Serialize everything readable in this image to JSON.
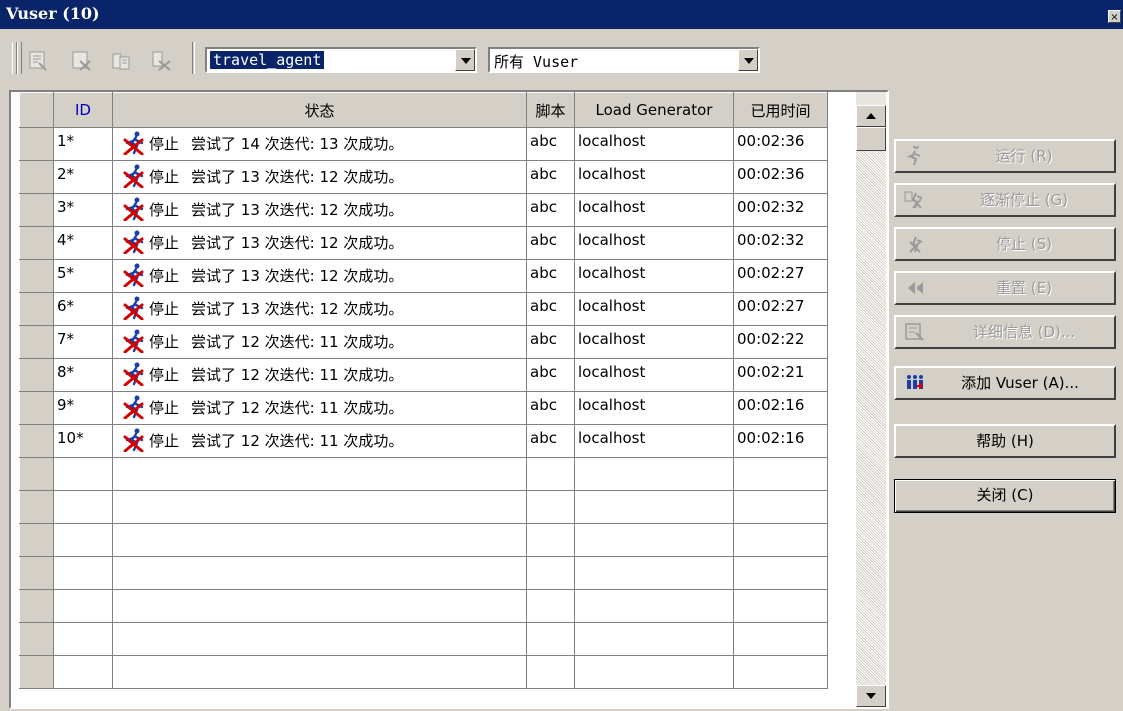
{
  "window": {
    "title": "Vuser (10)",
    "close_glyph": "×"
  },
  "toolbar": {
    "icons": [
      "vuser-details-icon",
      "vuser-stop-icon",
      "vuser-log-icon",
      "vuser-filter-icon"
    ],
    "group_combo": {
      "value": "travel_agent"
    },
    "filter_combo": {
      "value": "所有 Vuser"
    }
  },
  "grid": {
    "columns": [
      "ID",
      "状态",
      "脚本",
      "Load Generator",
      "已用时间"
    ],
    "rows": [
      {
        "id": "1*",
        "status_word": "停止",
        "status_detail": "尝试了 14 次迭代: 13 次成功。",
        "script": "abc",
        "generator": "localhost",
        "elapsed": "00:02:36"
      },
      {
        "id": "2*",
        "status_word": "停止",
        "status_detail": "尝试了 13 次迭代: 12 次成功。",
        "script": "abc",
        "generator": "localhost",
        "elapsed": "00:02:36"
      },
      {
        "id": "3*",
        "status_word": "停止",
        "status_detail": "尝试了 13 次迭代: 12 次成功。",
        "script": "abc",
        "generator": "localhost",
        "elapsed": "00:02:32"
      },
      {
        "id": "4*",
        "status_word": "停止",
        "status_detail": "尝试了 13 次迭代: 12 次成功。",
        "script": "abc",
        "generator": "localhost",
        "elapsed": "00:02:32"
      },
      {
        "id": "5*",
        "status_word": "停止",
        "status_detail": "尝试了 13 次迭代: 12 次成功。",
        "script": "abc",
        "generator": "localhost",
        "elapsed": "00:02:27"
      },
      {
        "id": "6*",
        "status_word": "停止",
        "status_detail": "尝试了 13 次迭代: 12 次成功。",
        "script": "abc",
        "generator": "localhost",
        "elapsed": "00:02:27"
      },
      {
        "id": "7*",
        "status_word": "停止",
        "status_detail": "尝试了 12 次迭代: 11 次成功。",
        "script": "abc",
        "generator": "localhost",
        "elapsed": "00:02:22"
      },
      {
        "id": "8*",
        "status_word": "停止",
        "status_detail": "尝试了 12 次迭代: 11 次成功。",
        "script": "abc",
        "generator": "localhost",
        "elapsed": "00:02:21"
      },
      {
        "id": "9*",
        "status_word": "停止",
        "status_detail": "尝试了 12 次迭代: 11 次成功。",
        "script": "abc",
        "generator": "localhost",
        "elapsed": "00:02:16"
      },
      {
        "id": "10*",
        "status_word": "停止",
        "status_detail": "尝试了 12 次迭代: 11 次成功。",
        "script": "abc",
        "generator": "localhost",
        "elapsed": "00:02:16"
      }
    ],
    "status_icon": "stopped-runner-icon"
  },
  "actions": {
    "run": {
      "label": "运行 (R)",
      "icon": "run-icon",
      "enabled": false
    },
    "gradual_stop": {
      "label": "逐渐停止 (G)",
      "icon": "gradual-stop-icon",
      "enabled": false
    },
    "stop": {
      "label": "停止 (S)",
      "icon": "stop-icon",
      "enabled": false
    },
    "reset": {
      "label": "重置 (E)",
      "icon": "reset-icon",
      "enabled": false
    },
    "details": {
      "label": "详细信息 (D)...",
      "icon": "details-icon",
      "enabled": false
    },
    "add_vuser": {
      "label": "添加 Vuser (A)...",
      "icon": "add-vuser-icon",
      "enabled": true
    },
    "help": {
      "label": "帮助 (H)",
      "enabled": true
    },
    "close": {
      "label": "关闭 (C)",
      "enabled": true
    }
  },
  "colors": {
    "titlebar": "#0a246a",
    "face": "#d4d0c8",
    "status_icon_red": "#d40000",
    "status_icon_blue": "#1a3fa8"
  }
}
